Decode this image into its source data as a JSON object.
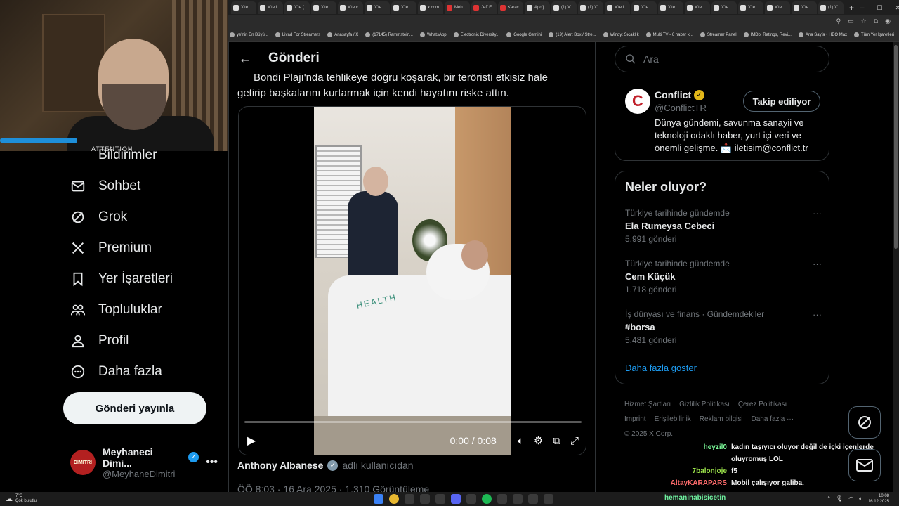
{
  "browser": {
    "tabs": [
      "X'te",
      "X'te I",
      "X'te (",
      "X'te",
      "X'te c",
      "X'te I",
      "X'te",
      "x.com",
      "Meh",
      "Jeff E",
      "Karac",
      "Apo'j",
      "(1) X'",
      "(1) X'",
      "X'te I",
      "X'te",
      "X'te",
      "X'te",
      "X'te",
      "X'te",
      "X'te",
      "X'te",
      "(1) X'"
    ],
    "bookmarks": [
      "ye'nin En Büyü...",
      "Livad For Streamers",
      "Anasayfa / X",
      "(17145) Rammstein...",
      "WhatsApp",
      "Electronic Diversity...",
      "Google Gemini",
      "(19) Alert Box / Stre...",
      "Windy: Sıcaklık",
      "Multi TV - 6 haber k...",
      "Streamer Panel",
      "IMDb: Ratings, Revi...",
      "Ana Sayfa • HBO Max"
    ],
    "bookmarks_right": "Tüm Yer İşaretleri"
  },
  "webcam": {
    "shirt_text": "ATTENTION"
  },
  "nav": {
    "partial_item": "Bildirimler",
    "items": [
      {
        "label": "Sohbet",
        "icon": "mail-icon"
      },
      {
        "label": "Grok",
        "icon": "grok-icon"
      },
      {
        "label": "Premium",
        "icon": "x-logo-icon"
      },
      {
        "label": "Yer İşaretleri",
        "icon": "bookmark-icon"
      },
      {
        "label": "Topluluklar",
        "icon": "communities-icon"
      },
      {
        "label": "Profil",
        "icon": "profile-icon"
      },
      {
        "label": "Daha fazla",
        "icon": "more-circle-icon"
      }
    ],
    "post_button": "Gönderi yayınla",
    "account": {
      "name": "Meyhaneci Dimi...",
      "handle": "@MeyhaneDimitri",
      "avatar_text": "DIMITRI"
    }
  },
  "main": {
    "back_label": "←",
    "title": "Gönderi",
    "tweet_line1": "Bondi Plajı'nda tehlikeye doğru koşarak, bir teröristi etkisiz hale",
    "tweet_line2": "getirip başkalarını kurtarmak için kendi hayatını riske attın.",
    "video": {
      "time": "0:00 / 0:08",
      "progress": 0.0,
      "bed_text": "HEALTH"
    },
    "author": {
      "name": "Anthony Albanese",
      "subtitle": "adlı kullanıcıdan"
    },
    "meta": "ÖÖ 8:03 · 16 Ara 2025 · 1.310 Görüntüleme"
  },
  "right": {
    "search_placeholder": "Ara",
    "conflict": {
      "logo_letter": "C",
      "name": "Conflict",
      "handle": "@ConflictTR",
      "follow_label": "Takip ediliyor",
      "bio": "Dünya gündemi, savunma sanayii ve teknoloji odaklı haber, yurt içi veri ve önemli gelişme. 📩 iletisim@conflict.tr"
    },
    "trends": {
      "heading": "Neler oluyor?",
      "items": [
        {
          "category": "Türkiye tarihinde gündemde",
          "topic": "Ela Rumeysa Cebeci",
          "count": "5.991 gönderi"
        },
        {
          "category": "Türkiye tarihinde gündemde",
          "topic": "Cem Küçük",
          "count": "1.718 gönderi"
        },
        {
          "category": "İş dünyası ve finans · Gündemdekiler",
          "topic": "#borsa",
          "count": "5.481 gönderi"
        }
      ],
      "show_more": "Daha fazla göster"
    },
    "footer": {
      "links": [
        "Hizmet Şartları",
        "Gizlilik Politikası",
        "Çerez Politikası",
        "Imprint",
        "Erişilebilirlik",
        "Reklam bilgisi",
        "Daha fazla ···"
      ],
      "copyright": "© 2025 X Corp."
    }
  },
  "chat": [
    {
      "user": "heyzil0",
      "color": "#7cfc9a",
      "message": "kadın taşıyıcı oluyor değil de içki içenlerde oluyromuş LOL"
    },
    {
      "user": "7balonjoje",
      "color": "#9be34a",
      "message": "f5"
    },
    {
      "user": "AltayKARAPARS",
      "color": "#ff6b6b",
      "message": "Mobil çalışıyor galiba."
    }
  ],
  "taskbar": {
    "weather_temp": "7°C",
    "weather_desc": "Çok bulutlu",
    "last_chat_user": "hemaninabisicetin",
    "time": "10:08",
    "date": "16.12.2025"
  }
}
